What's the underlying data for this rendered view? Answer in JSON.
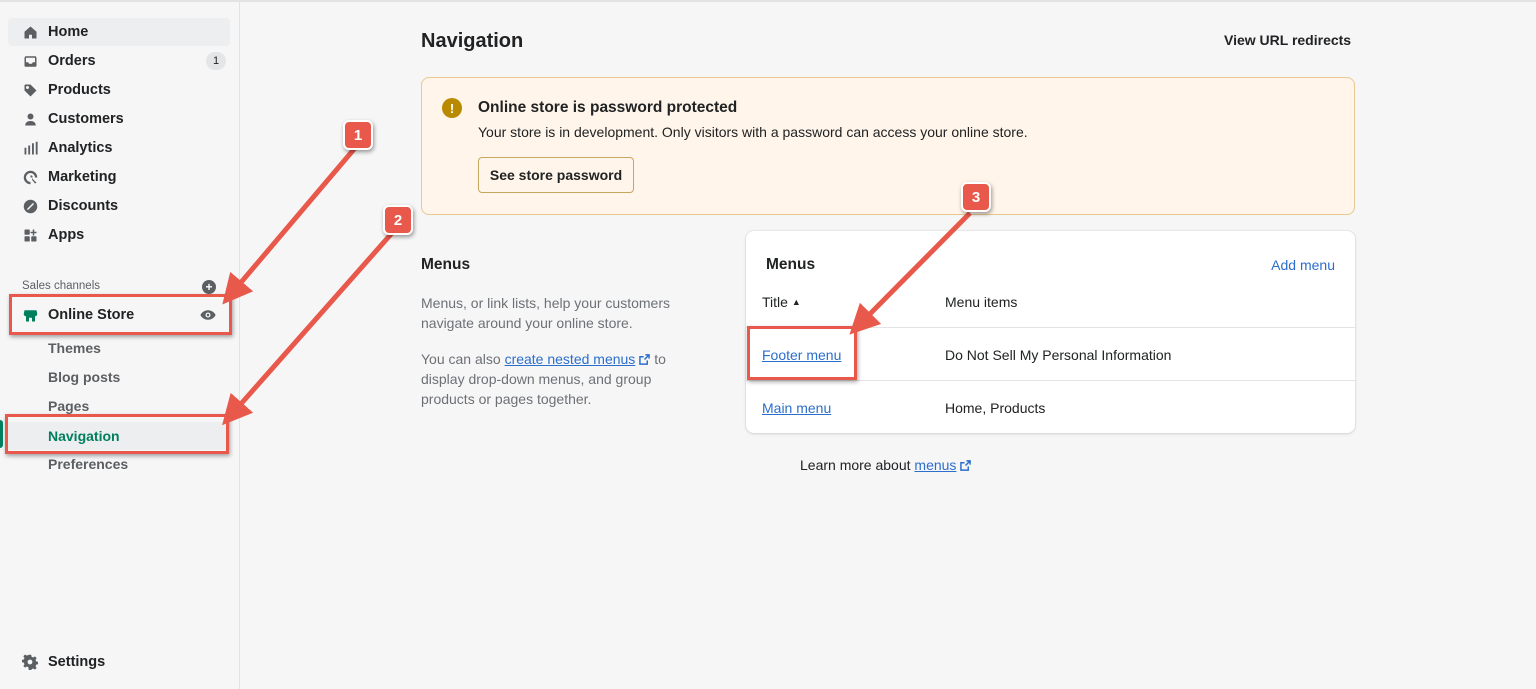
{
  "sidebar": {
    "items": [
      {
        "label": "Home",
        "icon": "home-icon"
      },
      {
        "label": "Orders",
        "icon": "inbox-icon",
        "badge": "1"
      },
      {
        "label": "Products",
        "icon": "tag-icon"
      },
      {
        "label": "Customers",
        "icon": "person-icon"
      },
      {
        "label": "Analytics",
        "icon": "bar-chart-icon"
      },
      {
        "label": "Marketing",
        "icon": "target-icon"
      },
      {
        "label": "Discounts",
        "icon": "discount-icon"
      },
      {
        "label": "Apps",
        "icon": "apps-icon"
      }
    ],
    "sales_channels_label": "Sales channels",
    "online_store": {
      "label": "Online Store",
      "icon": "store-icon"
    },
    "sub_items": [
      "Themes",
      "Blog posts",
      "Pages",
      "Navigation",
      "Preferences"
    ],
    "settings_label": "Settings"
  },
  "main": {
    "title": "Navigation",
    "view_url_redirects": "View URL redirects",
    "banner": {
      "title": "Online store is password protected",
      "text": "Your store is in development. Only visitors with a password can access your online store.",
      "button": "See store password"
    },
    "menus_section": {
      "heading": "Menus",
      "description": "Menus, or link lists, help your customers navigate around your online store.",
      "desc2_prefix": "You can also ",
      "desc2_link": "create nested menus",
      "desc2_suffix": " to display drop-down menus, and group products or pages together."
    },
    "card": {
      "title": "Menus",
      "add_menu": "Add menu",
      "col_title": "Title",
      "col_items": "Menu items",
      "rows": [
        {
          "title": "Footer menu",
          "items": "Do Not Sell My Personal Information"
        },
        {
          "title": "Main menu",
          "items": "Home, Products"
        }
      ]
    },
    "learn_more_prefix": "Learn more about ",
    "learn_more_link": "menus"
  },
  "annotations": {
    "markers": [
      "1",
      "2",
      "3"
    ],
    "color": "#e8594b"
  },
  "colors": {
    "accent_green": "#008060",
    "link_blue": "#2c6ecb",
    "banner_bg": "#fff5ea"
  }
}
